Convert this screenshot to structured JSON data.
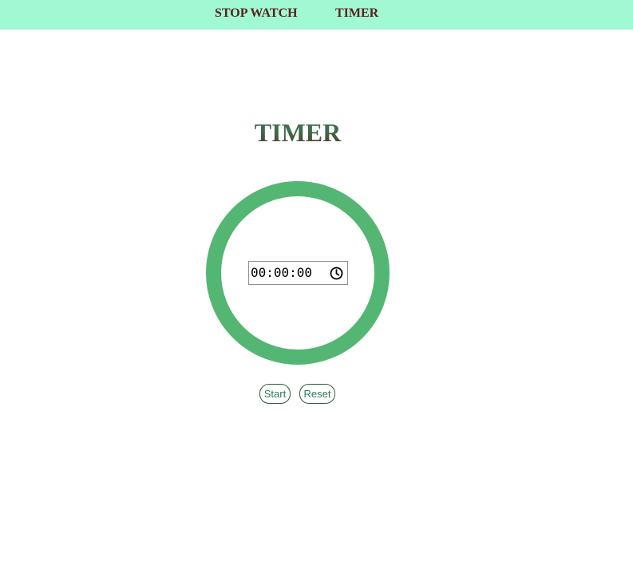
{
  "nav": {
    "stopwatch_label": "STOP WATCH",
    "timer_label": "TIMER"
  },
  "page": {
    "title": "TIMER"
  },
  "timer": {
    "input_value": "00:00:00",
    "clock_icon": "clock-icon"
  },
  "controls": {
    "start_label": "Start",
    "reset_label": "Reset"
  },
  "colors": {
    "navbar_bg": "#a0f9d2",
    "nav_text": "#5a2020",
    "ring": "#54b673",
    "title_green": "#3d6e4c",
    "title_brown": "#5a3030",
    "button_text": "#2e7a55",
    "button_border": "#2d5a40"
  }
}
